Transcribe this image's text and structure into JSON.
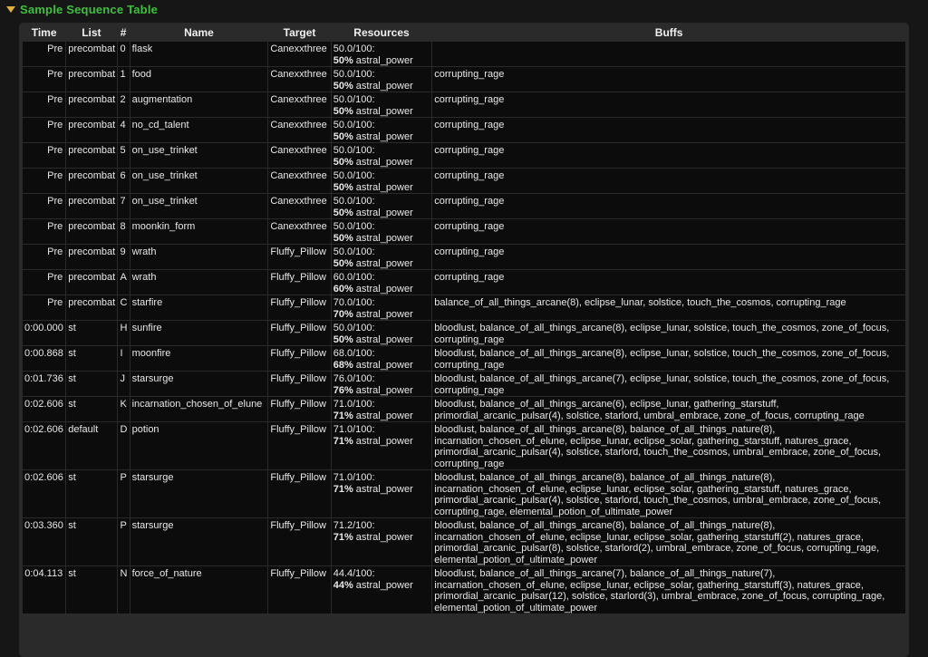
{
  "header": {
    "title": "Sample Sequence Table"
  },
  "table": {
    "columns": [
      "Time",
      "List",
      "#",
      "Name",
      "Target",
      "Resources",
      "Buffs"
    ],
    "rows": [
      {
        "time": "Pre",
        "list": "precombat",
        "num": "0",
        "name": "flask",
        "target": "Canexxthree",
        "res_val": "50.0/100:",
        "res_pct": "50%",
        "res_type": "astral_power",
        "buffs": ""
      },
      {
        "time": "Pre",
        "list": "precombat",
        "num": "1",
        "name": "food",
        "target": "Canexxthree",
        "res_val": "50.0/100:",
        "res_pct": "50%",
        "res_type": "astral_power",
        "buffs": "corrupting_rage"
      },
      {
        "time": "Pre",
        "list": "precombat",
        "num": "2",
        "name": "augmentation",
        "target": "Canexxthree",
        "res_val": "50.0/100:",
        "res_pct": "50%",
        "res_type": "astral_power",
        "buffs": "corrupting_rage"
      },
      {
        "time": "Pre",
        "list": "precombat",
        "num": "4",
        "name": "no_cd_talent",
        "target": "Canexxthree",
        "res_val": "50.0/100:",
        "res_pct": "50%",
        "res_type": "astral_power",
        "buffs": "corrupting_rage"
      },
      {
        "time": "Pre",
        "list": "precombat",
        "num": "5",
        "name": "on_use_trinket",
        "target": "Canexxthree",
        "res_val": "50.0/100:",
        "res_pct": "50%",
        "res_type": "astral_power",
        "buffs": "corrupting_rage"
      },
      {
        "time": "Pre",
        "list": "precombat",
        "num": "6",
        "name": "on_use_trinket",
        "target": "Canexxthree",
        "res_val": "50.0/100:",
        "res_pct": "50%",
        "res_type": "astral_power",
        "buffs": "corrupting_rage"
      },
      {
        "time": "Pre",
        "list": "precombat",
        "num": "7",
        "name": "on_use_trinket",
        "target": "Canexxthree",
        "res_val": "50.0/100:",
        "res_pct": "50%",
        "res_type": "astral_power",
        "buffs": "corrupting_rage"
      },
      {
        "time": "Pre",
        "list": "precombat",
        "num": "8",
        "name": "moonkin_form",
        "target": "Canexxthree",
        "res_val": "50.0/100:",
        "res_pct": "50%",
        "res_type": "astral_power",
        "buffs": "corrupting_rage"
      },
      {
        "time": "Pre",
        "list": "precombat",
        "num": "9",
        "name": "wrath",
        "target": "Fluffy_Pillow",
        "res_val": "50.0/100:",
        "res_pct": "50%",
        "res_type": "astral_power",
        "buffs": "corrupting_rage"
      },
      {
        "time": "Pre",
        "list": "precombat",
        "num": "A",
        "name": "wrath",
        "target": "Fluffy_Pillow",
        "res_val": "60.0/100:",
        "res_pct": "60%",
        "res_type": "astral_power",
        "buffs": "corrupting_rage"
      },
      {
        "time": "Pre",
        "list": "precombat",
        "num": "C",
        "name": "starfire",
        "target": "Fluffy_Pillow",
        "res_val": "70.0/100:",
        "res_pct": "70%",
        "res_type": "astral_power",
        "buffs": "balance_of_all_things_arcane(8), eclipse_lunar, solstice, touch_the_cosmos, corrupting_rage"
      },
      {
        "time": "0:00.000",
        "list": "st",
        "num": "H",
        "name": "sunfire",
        "target": "Fluffy_Pillow",
        "res_val": "50.0/100:",
        "res_pct": "50%",
        "res_type": "astral_power",
        "buffs": "bloodlust, balance_of_all_things_arcane(8), eclipse_lunar, solstice, touch_the_cosmos, zone_of_focus, corrupting_rage"
      },
      {
        "time": "0:00.868",
        "list": "st",
        "num": "I",
        "name": "moonfire",
        "target": "Fluffy_Pillow",
        "res_val": "68.0/100:",
        "res_pct": "68%",
        "res_type": "astral_power",
        "buffs": "bloodlust, balance_of_all_things_arcane(8), eclipse_lunar, solstice, touch_the_cosmos, zone_of_focus, corrupting_rage"
      },
      {
        "time": "0:01.736",
        "list": "st",
        "num": "J",
        "name": "starsurge",
        "target": "Fluffy_Pillow",
        "res_val": "76.0/100:",
        "res_pct": "76%",
        "res_type": "astral_power",
        "buffs": "bloodlust, balance_of_all_things_arcane(7), eclipse_lunar, solstice, touch_the_cosmos, zone_of_focus, corrupting_rage"
      },
      {
        "time": "0:02.606",
        "list": "st",
        "num": "K",
        "name": "incarnation_chosen_of_elune",
        "target": "Fluffy_Pillow",
        "res_val": "71.0/100:",
        "res_pct": "71%",
        "res_type": "astral_power",
        "buffs": "bloodlust, balance_of_all_things_arcane(6), eclipse_lunar, gathering_starstuff, primordial_arcanic_pulsar(4), solstice, starlord, umbral_embrace, zone_of_focus, corrupting_rage"
      },
      {
        "time": "0:02.606",
        "list": "default",
        "num": "D",
        "name": "potion",
        "target": "Fluffy_Pillow",
        "res_val": "71.0/100:",
        "res_pct": "71%",
        "res_type": "astral_power",
        "buffs": "bloodlust, balance_of_all_things_arcane(8), balance_of_all_things_nature(8), incarnation_chosen_of_elune, eclipse_lunar, eclipse_solar, gathering_starstuff, natures_grace, primordial_arcanic_pulsar(4), solstice, starlord, touch_the_cosmos, umbral_embrace, zone_of_focus, corrupting_rage"
      },
      {
        "time": "0:02.606",
        "list": "st",
        "num": "P",
        "name": "starsurge",
        "target": "Fluffy_Pillow",
        "res_val": "71.0/100:",
        "res_pct": "71%",
        "res_type": "astral_power",
        "buffs": "bloodlust, balance_of_all_things_arcane(8), balance_of_all_things_nature(8), incarnation_chosen_of_elune, eclipse_lunar, eclipse_solar, gathering_starstuff, natures_grace, primordial_arcanic_pulsar(4), solstice, starlord, touch_the_cosmos, umbral_embrace, zone_of_focus, corrupting_rage, elemental_potion_of_ultimate_power"
      },
      {
        "time": "0:03.360",
        "list": "st",
        "num": "P",
        "name": "starsurge",
        "target": "Fluffy_Pillow",
        "res_val": "71.2/100:",
        "res_pct": "71%",
        "res_type": "astral_power",
        "buffs": "bloodlust, balance_of_all_things_arcane(8), balance_of_all_things_nature(8), incarnation_chosen_of_elune, eclipse_lunar, eclipse_solar, gathering_starstuff(2), natures_grace, primordial_arcanic_pulsar(8), solstice, starlord(2), umbral_embrace, zone_of_focus, corrupting_rage, elemental_potion_of_ultimate_power"
      },
      {
        "time": "0:04.113",
        "list": "st",
        "num": "N",
        "name": "force_of_nature",
        "target": "Fluffy_Pillow",
        "res_val": "44.4/100:",
        "res_pct": "44%",
        "res_type": "astral_power",
        "buffs": "bloodlust, balance_of_all_things_arcane(7), balance_of_all_things_nature(7), incarnation_chosen_of_elune, eclipse_lunar, eclipse_solar, gathering_starstuff(3), natures_grace, primordial_arcanic_pulsar(12), solstice, starlord(3), umbral_embrace, zone_of_focus, corrupting_rage, elemental_potion_of_ultimate_power"
      }
    ]
  }
}
